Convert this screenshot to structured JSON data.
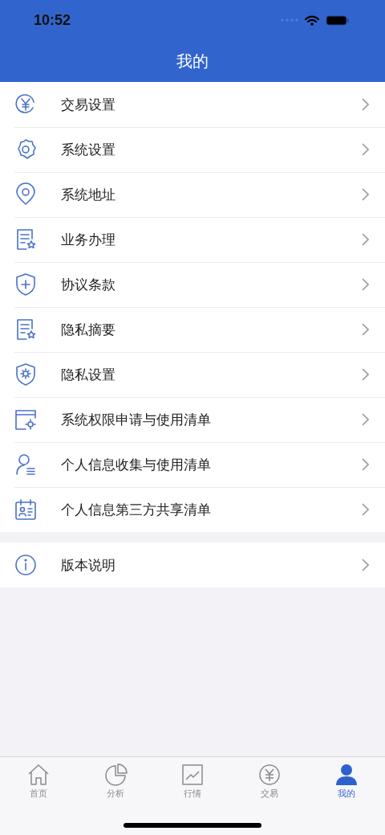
{
  "status_bar": {
    "time": "10:52"
  },
  "nav": {
    "title": "我的"
  },
  "sections": [
    {
      "items": [
        {
          "label": "交易设置",
          "kind": "yen"
        },
        {
          "label": "系统设置",
          "kind": "gear"
        },
        {
          "label": "系统地址",
          "kind": "pin"
        },
        {
          "label": "业务办理",
          "kind": "doc"
        },
        {
          "label": "协议条款",
          "kind": "shield"
        },
        {
          "label": "隐私摘要",
          "kind": "doc"
        },
        {
          "label": "隐私设置",
          "kind": "shieldgear"
        },
        {
          "label": "系统权限申请与使用清单",
          "kind": "window"
        },
        {
          "label": "个人信息收集与使用清单",
          "kind": "person"
        },
        {
          "label": "个人信息第三方共享清单",
          "kind": "card"
        }
      ]
    },
    {
      "items": [
        {
          "label": "版本说明",
          "kind": "info"
        }
      ]
    }
  ],
  "tabs": [
    {
      "label": "首页",
      "kind": "home",
      "selected": false
    },
    {
      "label": "分析",
      "kind": "pie",
      "selected": false
    },
    {
      "label": "行情",
      "kind": "chart",
      "selected": false
    },
    {
      "label": "交易",
      "kind": "yen",
      "selected": false
    },
    {
      "label": "我的",
      "kind": "user",
      "selected": true
    }
  ]
}
